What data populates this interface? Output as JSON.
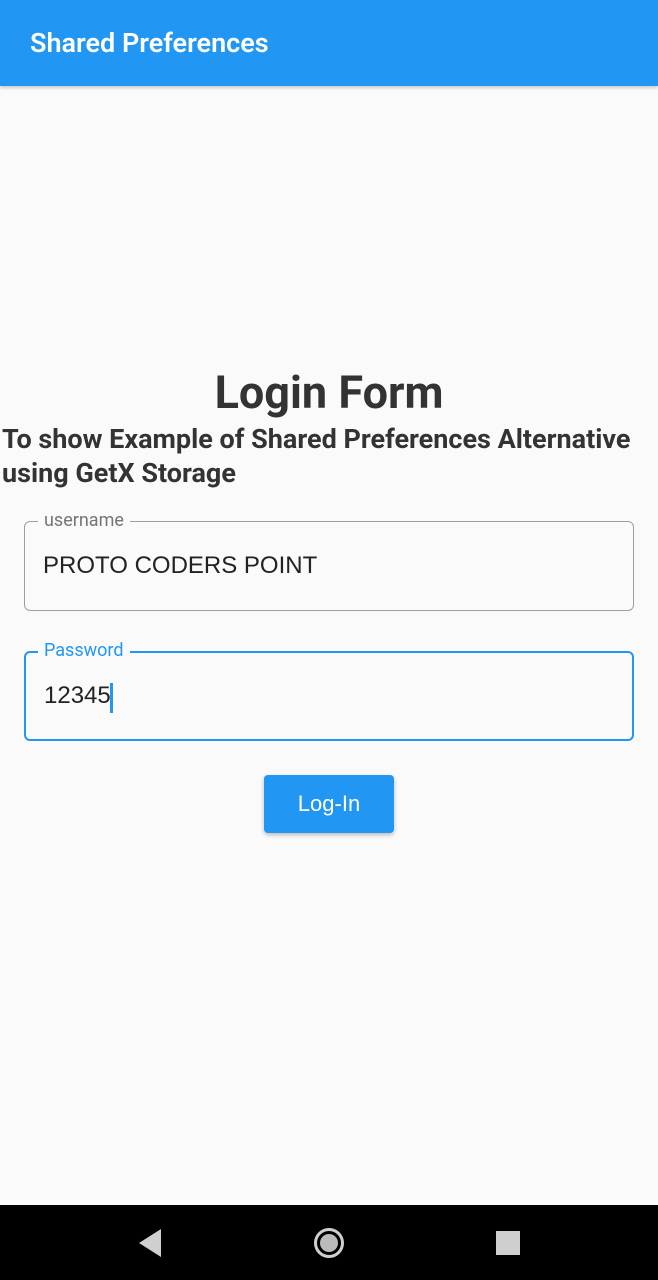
{
  "appbar": {
    "title": "Shared Preferences"
  },
  "form": {
    "heading": "Login Form",
    "subheading": "To show Example of Shared Preferences Alternative using GetX Storage",
    "username_label": "username",
    "username_value": "PROTO CODERS POINT",
    "password_label": "Password",
    "password_value": "12345",
    "login_label": "Log-In"
  },
  "colors": {
    "primary": "#2196f3"
  }
}
